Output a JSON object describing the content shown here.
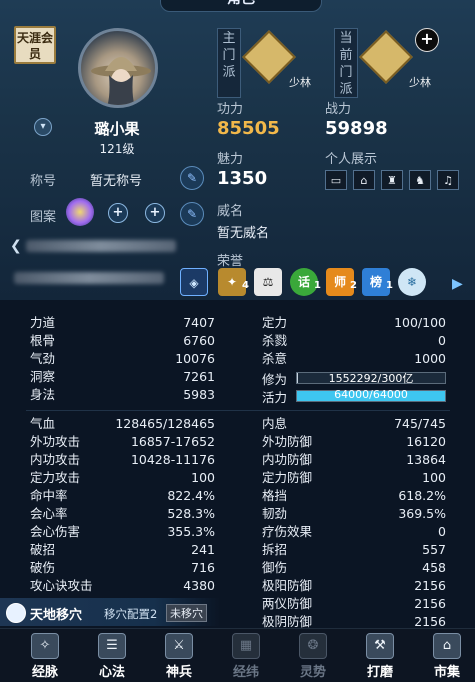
{
  "window": {
    "title": "角色"
  },
  "profile": {
    "vip_label": "天涯会员",
    "name": "璐小果",
    "level": "121级",
    "title_label": "称号",
    "title_value": "暂无称号",
    "pattern_label": "图案"
  },
  "sect": {
    "main_label": "主门派",
    "main_name": "少林",
    "current_label": "当前门派",
    "current_name": "少林"
  },
  "power": {
    "gongli_label": "功力",
    "gongli_value": "85505",
    "zhanli_label": "战力",
    "zhanli_value": "59898",
    "meili_label": "魅力",
    "meili_value": "1350",
    "showcase_label": "个人展示",
    "weiming_label": "威名",
    "weiming_value": "暂无威名",
    "rongyu_label": "荣誉"
  },
  "honors": [
    {
      "icon": "shield-badge-icon",
      "text": "",
      "sub": ""
    },
    {
      "icon": "gold-medal-icon",
      "text": "",
      "sub": "4"
    },
    {
      "icon": "scale-icon",
      "text": "",
      "sub": ""
    },
    {
      "icon": "talk-badge-icon",
      "text": "话",
      "sub": "1"
    },
    {
      "icon": "master-badge-icon",
      "text": "师",
      "sub": "2"
    },
    {
      "icon": "rank-badge-icon",
      "text": "榜",
      "sub": "1"
    },
    {
      "icon": "snow-badge-icon",
      "text": "",
      "sub": ""
    }
  ],
  "attributes_left": [
    {
      "label": "力道",
      "value": "7407"
    },
    {
      "label": "根骨",
      "value": "6760"
    },
    {
      "label": "气劲",
      "value": "10076"
    },
    {
      "label": "洞察",
      "value": "7261"
    },
    {
      "label": "身法",
      "value": "5983"
    }
  ],
  "attributes_right": [
    {
      "label": "定力",
      "value": "100/100"
    },
    {
      "label": "杀戮",
      "value": "0"
    },
    {
      "label": "杀意",
      "value": "1000"
    }
  ],
  "xiuwei": {
    "label": "修为",
    "text": "1552292/300亿",
    "fraction": 0.01
  },
  "huoli": {
    "label": "活力",
    "text": "64000/64000",
    "fraction": 1.0,
    "color": "#3ec6f0"
  },
  "combat_left": [
    {
      "label": "气血",
      "value": "128465/128465"
    },
    {
      "label": "外功攻击",
      "value": "16857-17652"
    },
    {
      "label": "内功攻击",
      "value": "10428-11176"
    },
    {
      "label": "定力攻击",
      "value": "100"
    },
    {
      "label": "命中率",
      "value": "822.4%"
    },
    {
      "label": "会心率",
      "value": "528.3%"
    },
    {
      "label": "会心伤害",
      "value": "355.3%"
    },
    {
      "label": "破招",
      "value": "241"
    },
    {
      "label": "破伤",
      "value": "716"
    },
    {
      "label": "攻心诀攻击",
      "value": "4380"
    }
  ],
  "combat_right": [
    {
      "label": "内息",
      "value": "745/745"
    },
    {
      "label": "外功防御",
      "value": "16120"
    },
    {
      "label": "内功防御",
      "value": "13864"
    },
    {
      "label": "定力防御",
      "value": "100"
    },
    {
      "label": "格挡",
      "value": "618.2%"
    },
    {
      "label": "韧劲",
      "value": "369.5%"
    },
    {
      "label": "疗伤效果",
      "value": "0"
    },
    {
      "label": "拆招",
      "value": "557"
    },
    {
      "label": "御伤",
      "value": "458"
    },
    {
      "label": "极阳防御",
      "value": "2156"
    },
    {
      "label": "两仪防御",
      "value": "2156"
    },
    {
      "label": "极阴防御",
      "value": "2156"
    }
  ],
  "skill_bar": {
    "name": "天地移穴",
    "config": "移穴配置2",
    "tag": "未移穴"
  },
  "nav": [
    {
      "label": "经脉",
      "icon": "meridian-icon",
      "dim": false
    },
    {
      "label": "心法",
      "icon": "book-icon",
      "dim": false
    },
    {
      "label": "神兵",
      "icon": "sword-icon",
      "dim": false
    },
    {
      "label": "经纬",
      "icon": "grid-icon",
      "dim": true
    },
    {
      "label": "灵势",
      "icon": "spirit-icon",
      "dim": true
    },
    {
      "label": "打磨",
      "icon": "hammer-icon",
      "dim": false
    },
    {
      "label": "市集",
      "icon": "market-icon",
      "dim": false
    }
  ],
  "colors": {
    "gold": "#f2b84a",
    "accent_blue": "#3ec6f0"
  }
}
